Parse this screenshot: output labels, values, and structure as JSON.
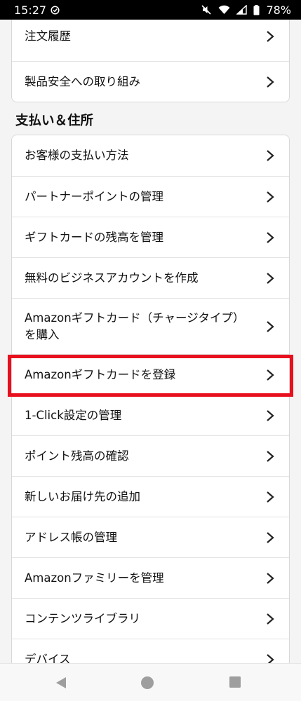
{
  "status_bar": {
    "time": "15:27",
    "battery": "78%",
    "icons": [
      "check-circle-icon",
      "mute-icon",
      "wifi-icon",
      "signal-icon",
      "battery-icon"
    ]
  },
  "account_section": {
    "items": [
      {
        "label": "注文履歴"
      },
      {
        "label": "製品安全への取り組み"
      }
    ]
  },
  "payment_section": {
    "heading": "支払い＆住所",
    "items": [
      {
        "label": "お客様の支払い方法"
      },
      {
        "label": "パートナーポイントの管理"
      },
      {
        "label": "ギフトカードの残高を管理"
      },
      {
        "label": "無料のビジネスアカウントを作成"
      },
      {
        "label": "Amazonギフトカード（チャージタイプ）を購入",
        "lines": [
          "Amazonギフトカード（チャージタイプ）",
          "を購入"
        ]
      },
      {
        "label": "Amazonギフトカードを登録",
        "highlighted": true
      },
      {
        "label": "1-Click設定の管理"
      },
      {
        "label": "ポイント残高の確認"
      },
      {
        "label": "新しいお届け先の追加"
      },
      {
        "label": "アドレス帳の管理"
      },
      {
        "label": "Amazonファミリーを管理"
      },
      {
        "label": "コンテンツライブラリ"
      },
      {
        "label": "デバイス"
      }
    ]
  },
  "highlight_color": "#e8101e",
  "nav_bar": {
    "buttons": [
      "back-icon",
      "home-icon",
      "recents-icon"
    ]
  }
}
